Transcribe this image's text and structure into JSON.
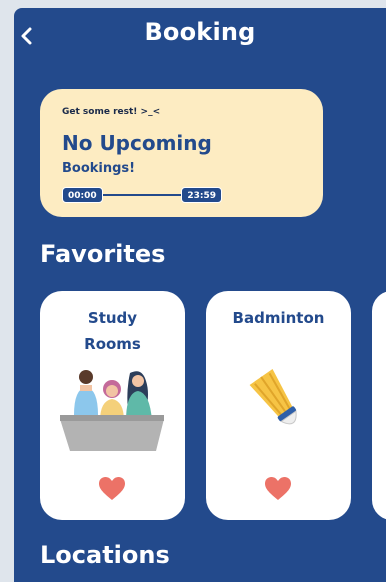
{
  "header": {
    "title": "Booking",
    "back_icon": "chevron-left-icon"
  },
  "status_card": {
    "note": "Get some rest! >_<",
    "headline": "No Upcoming",
    "subline": "Bookings!",
    "time_start": "00:00",
    "time_end": "23:59"
  },
  "favorites": {
    "title": "Favorites",
    "items": [
      {
        "label_line1": "Study",
        "label_line2": "Rooms",
        "icon": "study-group-illustration",
        "favorite_icon": "heart-icon"
      },
      {
        "label_line1": "Badminton",
        "icon": "shuttlecock-illustration",
        "favorite_icon": "heart-icon"
      }
    ]
  },
  "locations": {
    "title": "Locations"
  },
  "colors": {
    "background": "#234a8c",
    "card": "#ffffff",
    "status_card": "#fdecc2",
    "accent": "#234a8c",
    "heart": "#ec7267"
  }
}
